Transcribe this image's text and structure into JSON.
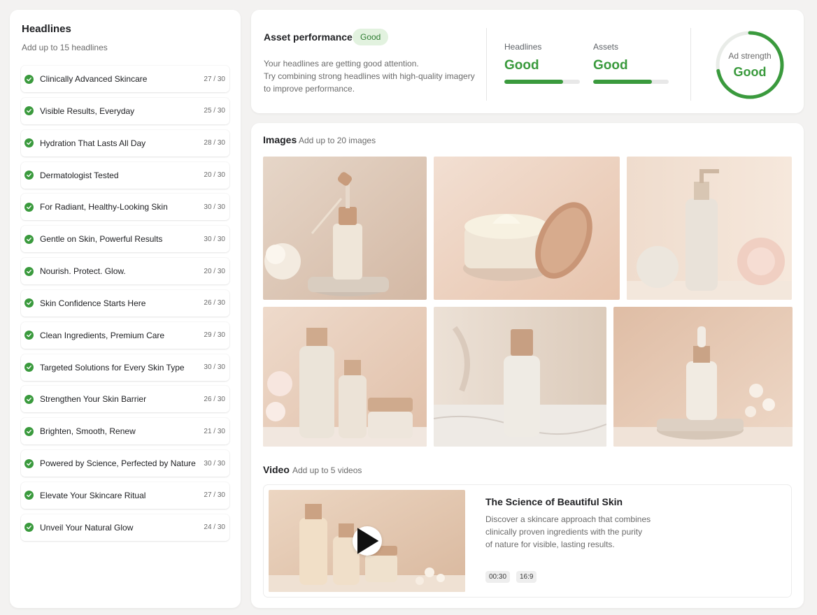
{
  "headlines": {
    "title": "Headlines",
    "subtitle": "Add up to 15 headlines",
    "items": [
      {
        "text": "Clinically Advanced Skincare",
        "count": "27 / 30"
      },
      {
        "text": "Visible Results, Everyday",
        "count": "25 / 30"
      },
      {
        "text": "Hydration That Lasts All Day",
        "count": "28 / 30"
      },
      {
        "text": "Dermatologist Tested",
        "count": "20 / 30"
      },
      {
        "text": "For Radiant, Healthy-Looking Skin",
        "count": "30 / 30"
      },
      {
        "text": "Gentle on Skin, Powerful Results",
        "count": "30 / 30"
      },
      {
        "text": "Nourish. Protect. Glow.",
        "count": "20 / 30"
      },
      {
        "text": "Skin Confidence Starts Here",
        "count": "26 / 30"
      },
      {
        "text": "Clean Ingredients, Premium Care",
        "count": "29 / 30"
      },
      {
        "text": "Targeted Solutions for Every Skin Type",
        "count": "30 / 30"
      },
      {
        "text": "Strengthen Your Skin Barrier",
        "count": "26 / 30"
      },
      {
        "text": "Brighten, Smooth, Renew",
        "count": "21 / 30"
      },
      {
        "text": "Powered by Science, Perfected by Nature",
        "count": "30 / 30"
      },
      {
        "text": "Elevate Your Skincare Ritual",
        "count": "27 / 30"
      },
      {
        "text": "Unveil Your Natural Glow",
        "count": "24 / 30"
      }
    ]
  },
  "performance": {
    "title": "Asset performance",
    "badge": "Good",
    "description_line1": "Your headlines are getting good attention.",
    "description_line2": "Try combining strong headlines with high-quality imagery",
    "description_line3": "to improve performance.",
    "metrics": [
      {
        "label": "Headlines",
        "value": "Good",
        "level": 0.78
      },
      {
        "label": "Assets",
        "value": "Good",
        "level": 0.78
      }
    ],
    "ad_strength": {
      "label": "Ad strength",
      "value": "Good",
      "level": 0.72
    },
    "colors": {
      "good": "#3a9a3d",
      "badge_bg": "#e2f2df"
    }
  },
  "images": {
    "title": "Images",
    "subtitle": "Add up to 20 images"
  },
  "video": {
    "title": "Video",
    "subtitle": "Add up to 5 videos",
    "card_title": "The Science of Beautiful Skin",
    "desc_line1": "Discover a skincare approach that combines",
    "desc_line2": "clinically proven ingredients with the purity",
    "desc_line3": "of nature for visible, lasting results.",
    "duration": "00:30",
    "aspect": "16:9"
  }
}
